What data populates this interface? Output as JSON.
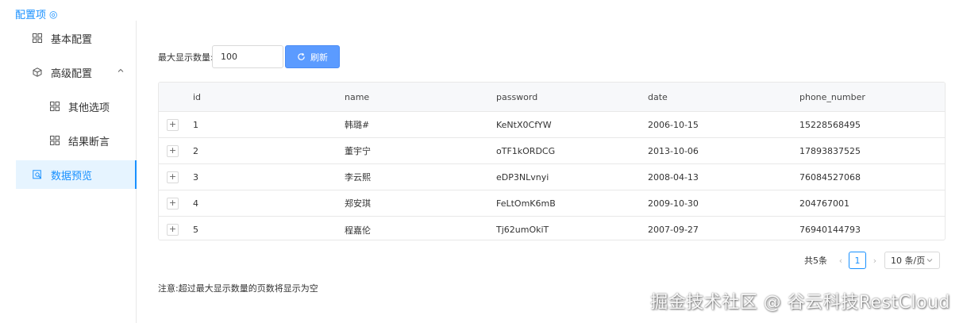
{
  "header": {
    "title": "配置项",
    "title_icon": "target-icon"
  },
  "sidebar": {
    "items": [
      {
        "label": "基本配置",
        "icon": "grid-icon"
      },
      {
        "label": "高级配置",
        "icon": "cube-icon",
        "expanded": true
      },
      {
        "label": "其他选项",
        "icon": "grid-icon"
      },
      {
        "label": "结果断言",
        "icon": "grid-icon"
      },
      {
        "label": "数据预览",
        "icon": "preview-icon",
        "selected": true
      }
    ]
  },
  "toolbar": {
    "max_label": "最大显示数量:",
    "max_value": "100",
    "refresh_label": "刷新"
  },
  "table": {
    "columns": [
      "id",
      "name",
      "password",
      "date",
      "phone_number"
    ],
    "rows": [
      {
        "id": "1",
        "name": "韩璐#",
        "password": "KeNtX0CfYW",
        "date": "2006-10-15",
        "phone_number": "15228568495"
      },
      {
        "id": "2",
        "name": "董宇宁",
        "password": "oTF1kORDCG",
        "date": "2013-10-06",
        "phone_number": "17893837525"
      },
      {
        "id": "3",
        "name": "李云熙",
        "password": "eDP3NLvnyi",
        "date": "2008-04-13",
        "phone_number": "76084527068"
      },
      {
        "id": "4",
        "name": "郑安琪",
        "password": "FeLtOmK6mB",
        "date": "2009-10-30",
        "phone_number": "204767001"
      },
      {
        "id": "5",
        "name": "程嘉伦",
        "password": "Tj62umOkiT",
        "date": "2007-09-27",
        "phone_number": "76940144793"
      }
    ],
    "expand_symbol": "+"
  },
  "pagination": {
    "total": "共5条",
    "prev": "‹",
    "current": "1",
    "next": "›",
    "page_size": "10 条/页"
  },
  "note": "注意:超过最大显示数量的页数将显示为空",
  "watermark": "掘金技术社区 @ 谷云科技RestCloud",
  "colors": {
    "accent": "#1890ff",
    "button": "#5b9bff",
    "selected_bg": "#e6f4ff"
  }
}
